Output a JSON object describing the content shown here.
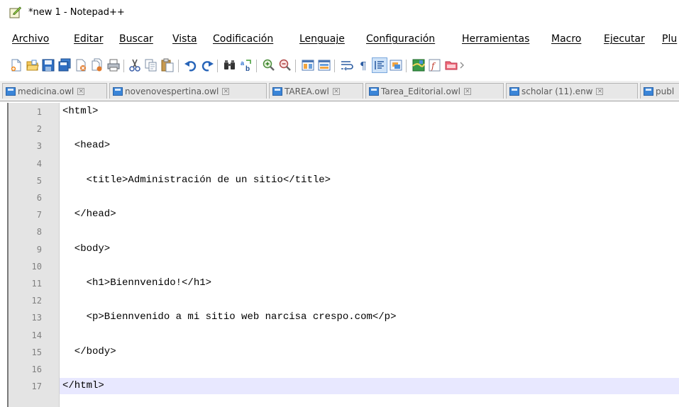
{
  "window": {
    "title": "*new 1 - Notepad++"
  },
  "menu": [
    "Archivo",
    "Editar",
    "Buscar",
    "Vista",
    "Codificación",
    "Lenguaje",
    "Configuración",
    "Herramientas",
    "Macro",
    "Ejecutar",
    "Plu"
  ],
  "toolbar": [
    "new-file-icon",
    "open-file-icon",
    "save-icon",
    "save-all-icon",
    "close-icon",
    "close-all-icon",
    "print-icon",
    "cut-icon",
    "copy-icon",
    "paste-icon",
    "undo-icon",
    "redo-icon",
    "find-icon",
    "replace-icon",
    "zoom-in-icon",
    "zoom-out-icon",
    "sync-vertical-icon",
    "sync-horizontal-icon",
    "word-wrap-icon",
    "show-all-characters-icon",
    "indent-guide-icon",
    "language-udl-icon",
    "document-map-icon",
    "function-list-icon",
    "folder-as-workspace-icon"
  ],
  "tabs": [
    {
      "label": "medicina.owl"
    },
    {
      "label": "novenovespertina.owl"
    },
    {
      "label": "TAREA.owl"
    },
    {
      "label": "Tarea_Editorial.owl"
    },
    {
      "label": "scholar (11).enw"
    },
    {
      "label": "publ"
    }
  ],
  "editor": {
    "current_line": 17,
    "lines": [
      "<html>",
      "",
      "  <head>",
      "",
      "    <title>Administración de un sitio</title>",
      "",
      "  </head>",
      "",
      "  <body>",
      "",
      "    <h1>Biennvenido!</h1>",
      "",
      "    <p>Biennvenido a mi sitio web narcisa crespo.com</p>",
      "",
      "  </body>",
      "",
      "</html>"
    ]
  }
}
